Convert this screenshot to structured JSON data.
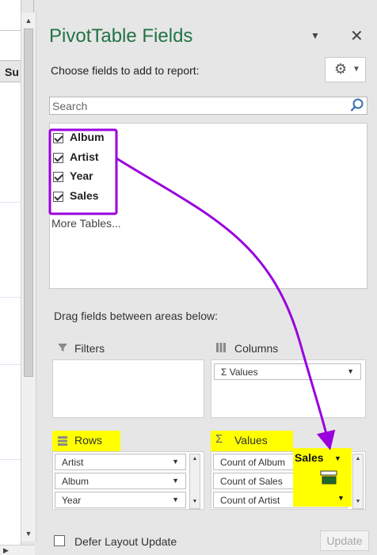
{
  "sheet": {
    "column_header": "Su"
  },
  "pane": {
    "title": "PivotTable Fields",
    "choose_label": "Choose fields to add to report:",
    "search_placeholder": "Search",
    "fields": [
      {
        "label": "Album",
        "checked": true
      },
      {
        "label": "Artist",
        "checked": true
      },
      {
        "label": "Year",
        "checked": true
      },
      {
        "label": "Sales",
        "checked": true
      }
    ],
    "more_tables": "More Tables...",
    "drag_label": "Drag fields between areas below:",
    "areas": {
      "filters": {
        "label": "Filters"
      },
      "columns": {
        "label": "Columns",
        "items": [
          "Values"
        ]
      },
      "rows": {
        "label": "Rows",
        "items": [
          "Artist",
          "Album",
          "Year"
        ]
      },
      "values": {
        "label": "Values",
        "items": [
          "Count of Album",
          "Count of Sales",
          "Count of Artist"
        ]
      }
    },
    "drag_ghost_label": "Sales",
    "defer_label": "Defer Layout Update",
    "defer_checked": false,
    "update_label": "Update"
  },
  "colors": {
    "title": "#217346",
    "annotation": "#9900dd",
    "highlight": "#ffff00"
  }
}
